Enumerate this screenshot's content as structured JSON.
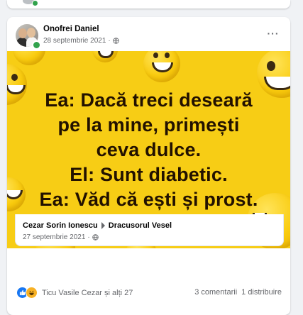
{
  "post": {
    "author": "Onofrei Daniel",
    "date": "28 septembrie 2021",
    "separator": "·",
    "privacy_icon": "globe-icon",
    "more_icon": "more-options-icon",
    "more_label": "···"
  },
  "meme": {
    "lines": [
      "Ea: Dacă treci deseară",
      "pe la mine, primești",
      "ceva dulce.",
      "El: Sunt diabetic.",
      "Ea: Văd că ești și prost."
    ],
    "background": "#f7cd15"
  },
  "shared_source": {
    "author": "Cezar Sorin Ionescu",
    "group": "Dracusorul Vesel",
    "date": "27 septembrie 2021",
    "separator": "·"
  },
  "engagement": {
    "reaction_icons": [
      "like-icon",
      "haha-icon"
    ],
    "reactions_text": "Ticu Vasile Cezar și alți 27",
    "comments": "3 comentarii",
    "shares": "1 distribuire"
  },
  "colors": {
    "like": "#1877f2",
    "haha": "#f7b125",
    "online": "#31a24c",
    "meta_text": "#65676b"
  }
}
